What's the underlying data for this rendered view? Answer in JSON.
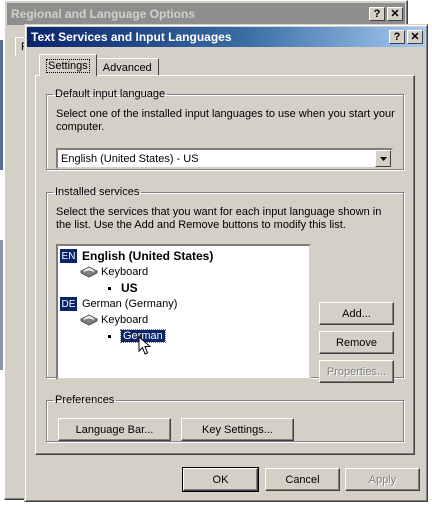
{
  "back_window": {
    "title": "Regional and Language Options",
    "tab_stub": "R"
  },
  "dialog": {
    "title": "Text Services and Input Languages",
    "help_button": "?",
    "close_button": "✕",
    "tabs": [
      {
        "label": "Settings",
        "active": true
      },
      {
        "label": "Advanced",
        "active": false
      }
    ],
    "default_input": {
      "legend": "Default input language",
      "description": "Select one of the installed input languages to use when you start your computer.",
      "selected": "English (United States) - US"
    },
    "installed": {
      "legend": "Installed services",
      "description": "Select the services that you want for each input language shown in the list. Use the Add and Remove buttons to modify this list.",
      "tree": [
        {
          "badge": "EN",
          "name": "English (United States)",
          "bold": true,
          "category": "Keyboard",
          "service": "US"
        },
        {
          "badge": "DE",
          "name": "German (Germany)",
          "bold": false,
          "category": "Keyboard",
          "service": "German"
        }
      ],
      "add_label": "Add...",
      "remove_label": "Remove",
      "properties_label": "Properties..."
    },
    "preferences": {
      "legend": "Preferences",
      "language_bar_label": "Language Bar...",
      "key_settings_label": "Key Settings..."
    },
    "footer": {
      "ok_label": "OK",
      "cancel_label": "Cancel",
      "apply_label": "Apply"
    }
  },
  "colors": {
    "face": "#d4d0c8",
    "selection": "#0a246a",
    "title_start": "#0a246a",
    "title_end": "#a6caf0"
  }
}
